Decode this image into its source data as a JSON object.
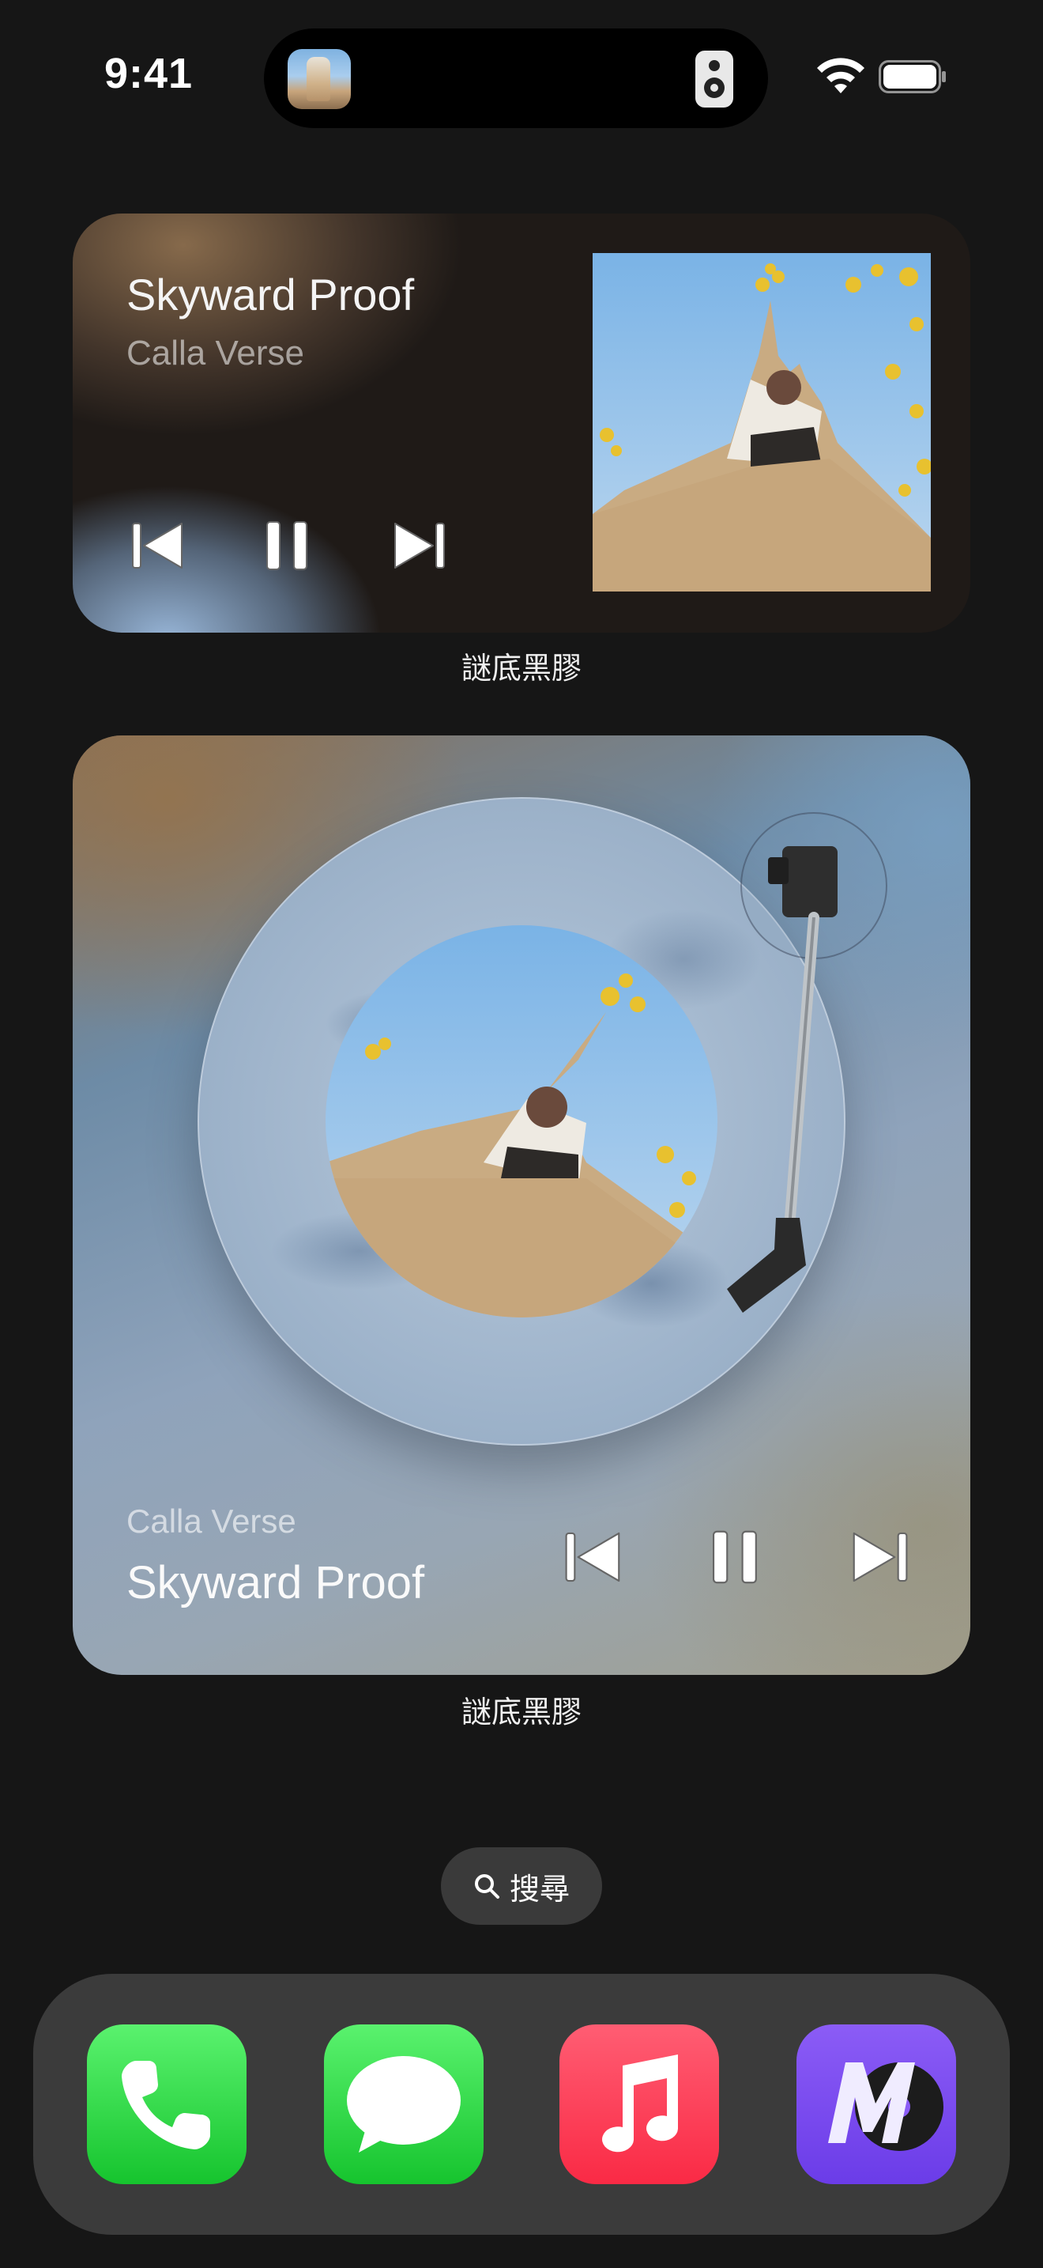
{
  "status_bar": {
    "time": "9:41",
    "icons": [
      "now-playing-artwork-icon",
      "speaker-icon",
      "wifi-icon",
      "battery-icon"
    ]
  },
  "widget_small": {
    "title": "Skyward Proof",
    "artist": "Calla Verse",
    "controls": [
      "previous-track",
      "pause",
      "next-track"
    ],
    "label": "謎底黑膠"
  },
  "widget_large": {
    "artist": "Calla Verse",
    "title": "Skyward Proof",
    "controls": [
      "previous-track",
      "pause",
      "next-track"
    ],
    "label": "謎底黑膠"
  },
  "search": {
    "label": "搜尋",
    "icon": "search-icon"
  },
  "dock": {
    "apps": [
      "Phone",
      "Messages",
      "Music",
      "謎底黑膠"
    ]
  }
}
